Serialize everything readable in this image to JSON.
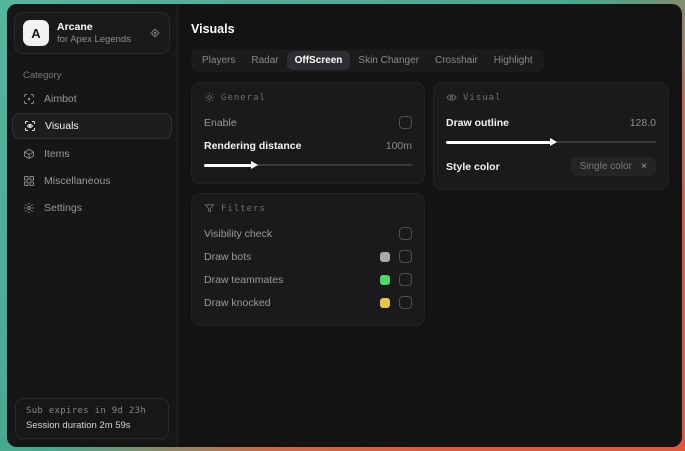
{
  "colors": {
    "bg_gradient_top": "#54b69c",
    "bg_gradient_bottom": "#e2573d",
    "window_bg": "#131314",
    "card_bg": "#1a1a1c",
    "active_pill": "#2e2e32",
    "swatch_bots": "#a9a9ac",
    "swatch_teammates": "#4cd964",
    "swatch_knocked": "#e3c44e"
  },
  "sidebar": {
    "brand": {
      "initial": "A",
      "name": "Arcane",
      "subtitle": "for Apex Legends"
    },
    "category_label": "Category",
    "items": [
      {
        "label": "Aimbot"
      },
      {
        "label": "Visuals"
      },
      {
        "label": "Items"
      },
      {
        "label": "Miscellaneous"
      },
      {
        "label": "Settings"
      }
    ],
    "footer": {
      "line1": "Sub expires in 9d 23h",
      "line2": "Session duration 2m 59s"
    }
  },
  "header": {
    "title": "Visuals"
  },
  "tabs": [
    {
      "label": "Players"
    },
    {
      "label": "Radar"
    },
    {
      "label": "OffScreen"
    },
    {
      "label": "Skin Changer"
    },
    {
      "label": "Crosshair"
    },
    {
      "label": "Highlight"
    }
  ],
  "general": {
    "title": "General",
    "enable_label": "Enable",
    "rendering_label": "Rendering distance",
    "rendering_value": "100m",
    "rendering_slider_pct": 23
  },
  "filters": {
    "title": "Filters",
    "rows": [
      {
        "label": "Visibility check"
      },
      {
        "label": "Draw bots",
        "swatch": "#a9a9ac"
      },
      {
        "label": "Draw teammates",
        "swatch": "#4cd964"
      },
      {
        "label": "Draw knocked",
        "swatch": "#e3c44e"
      }
    ]
  },
  "visual": {
    "title": "Visual",
    "outline_label": "Draw outline",
    "outline_value": "128.0",
    "outline_slider_pct": 50,
    "style_label": "Style color",
    "style_value": "Single color",
    "clear_glyph": "×"
  }
}
